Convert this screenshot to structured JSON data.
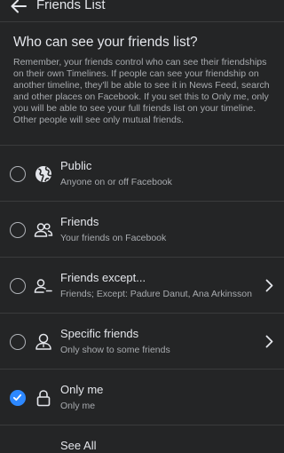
{
  "header": {
    "title": "Friends List",
    "back_icon": "back-arrow-icon"
  },
  "intro": {
    "title": "Who can see your friends list?",
    "description": "Remember, your friends control who can see their friendships on their own Timelines. If people can see your friendship on another timeline, they'll be able to see it in News Feed, search and other places on Facebook. If you set this to Only me, only you will be able to see your full friends list on your timeline. Other people will see only mutual friends."
  },
  "options": [
    {
      "label": "Public",
      "sublabel": "Anyone on or off Facebook",
      "icon": "globe-icon",
      "selected": false,
      "has_chevron": false
    },
    {
      "label": "Friends",
      "sublabel": "Your friends on Facebook",
      "icon": "friends-icon",
      "selected": false,
      "has_chevron": false
    },
    {
      "label": "Friends except...",
      "sublabel": "Friends; Except: Padure Danut, Ana Arkinsson",
      "icon": "friends-except-icon",
      "selected": false,
      "has_chevron": true
    },
    {
      "label": "Specific friends",
      "sublabel": "Only show to some friends",
      "icon": "specific-friend-icon",
      "selected": false,
      "has_chevron": true
    },
    {
      "label": "Only me",
      "sublabel": "Only me",
      "icon": "lock-icon",
      "selected": true,
      "has_chevron": false
    }
  ],
  "see_all": "See All",
  "colors": {
    "background": "#242526",
    "accent": "#2d88ff",
    "text_primary": "#e4e6eb",
    "text_secondary": "#a8abaf"
  }
}
